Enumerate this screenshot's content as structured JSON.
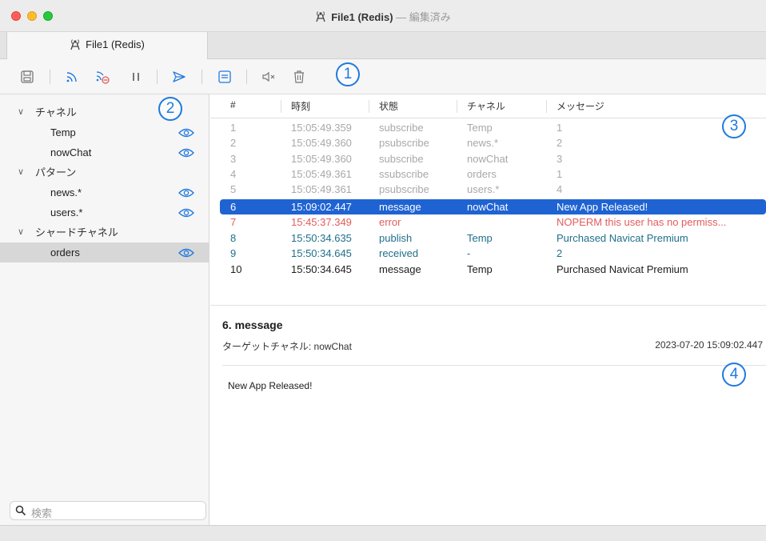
{
  "window": {
    "title": "File1 (Redis)",
    "subtitle": " — 編集済み",
    "icon": "radio-tower-icon"
  },
  "tabs": [
    {
      "label": "File1 (Redis)",
      "icon": "radio-tower-icon",
      "active": true
    }
  ],
  "toolbar": {
    "buttons": [
      {
        "name": "save",
        "icon": "save-icon"
      },
      {
        "name": "subscribe",
        "icon": "subscribe-icon"
      },
      {
        "name": "unsubscribe",
        "icon": "unsubscribe-icon"
      },
      {
        "name": "pause",
        "icon": "pause-icon"
      },
      {
        "name": "publish",
        "icon": "send-icon"
      },
      {
        "name": "save-log",
        "icon": "document-icon"
      },
      {
        "name": "mute",
        "icon": "mute-icon"
      },
      {
        "name": "clear",
        "icon": "trash-icon"
      }
    ]
  },
  "annotations": [
    "1",
    "2",
    "3",
    "4"
  ],
  "sidebar": {
    "groups": [
      {
        "label": "チャネル",
        "items": [
          "Temp",
          "nowChat"
        ]
      },
      {
        "label": "パターン",
        "items": [
          "news.*",
          "users.*"
        ]
      },
      {
        "label": "シャードチャネル",
        "items": [
          "orders"
        ]
      }
    ],
    "selected_item": "orders",
    "search_placeholder": "検索"
  },
  "table": {
    "columns": [
      "#",
      "時刻",
      "状態",
      "チャネル",
      "メッセージ"
    ],
    "rows": [
      {
        "num": "1",
        "time": "15:05:49.359",
        "state": "subscribe",
        "channel": "Temp",
        "message": "1",
        "style": "gray"
      },
      {
        "num": "2",
        "time": "15:05:49.360",
        "state": "psubscribe",
        "channel": "news.*",
        "message": "2",
        "style": "gray"
      },
      {
        "num": "3",
        "time": "15:05:49.360",
        "state": "subscribe",
        "channel": "nowChat",
        "message": "3",
        "style": "gray"
      },
      {
        "num": "4",
        "time": "15:05:49.361",
        "state": "ssubscribe",
        "channel": "orders",
        "message": "1",
        "style": "gray"
      },
      {
        "num": "5",
        "time": "15:05:49.361",
        "state": "psubscribe",
        "channel": "users.*",
        "message": "4",
        "style": "gray"
      },
      {
        "num": "6",
        "time": "15:09:02.447",
        "state": "message",
        "channel": "nowChat",
        "message": "New App Released!",
        "style": "sel"
      },
      {
        "num": "7",
        "time": "15:45:37.349",
        "state": "error",
        "channel": "",
        "message": "NOPERM this user has no permiss...",
        "style": "err"
      },
      {
        "num": "8",
        "time": "15:50:34.635",
        "state": "publish",
        "channel": "Temp",
        "message": "Purchased Navicat Premium",
        "style": "teal"
      },
      {
        "num": "9",
        "time": "15:50:34.645",
        "state": "received",
        "channel": "-",
        "message": "2",
        "style": "teal"
      },
      {
        "num": "10",
        "time": "15:50:34.645",
        "state": "message",
        "channel": "Temp",
        "message": "Purchased Navicat Premium",
        "style": "normal"
      }
    ]
  },
  "detail": {
    "title": "6. message",
    "channel_label": "ターゲットチャネル: nowChat",
    "timestamp": "2023-07-20 15:09:02.447",
    "body": "New App Released!"
  },
  "colors": {
    "accent": "#1f63d3",
    "error": "#e25c5c",
    "teal": "#1f6f8b",
    "annotation": "#1f7adf"
  }
}
